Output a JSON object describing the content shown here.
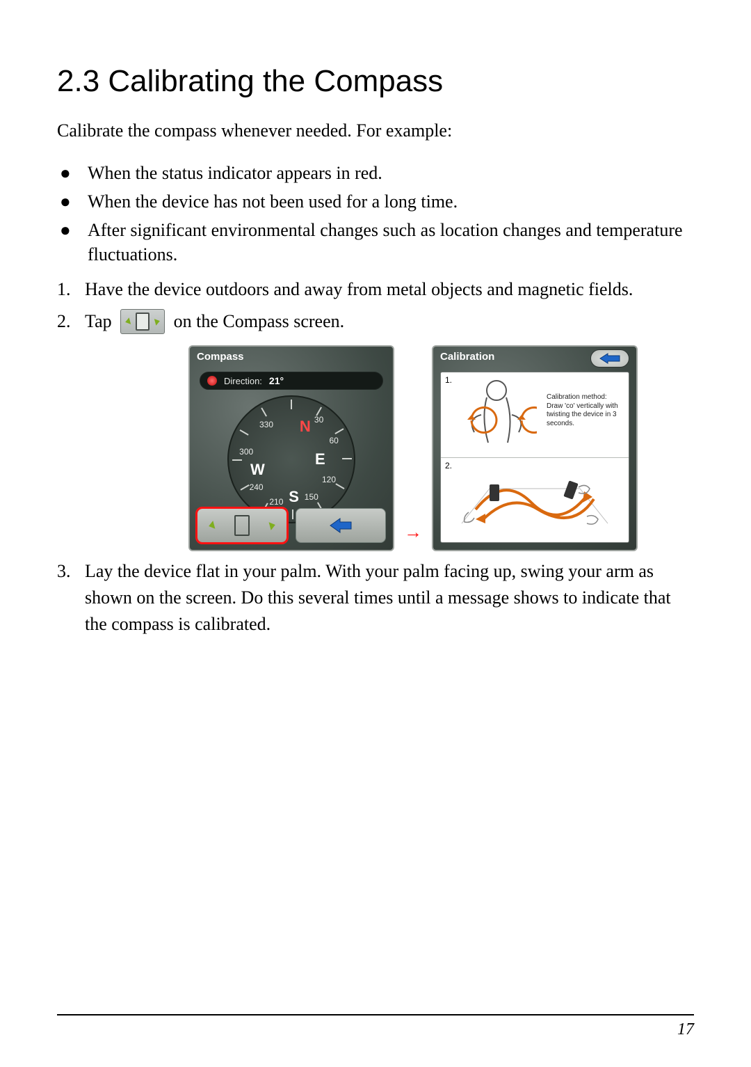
{
  "heading": "2.3   Calibrating the Compass",
  "intro": "Calibrate the compass whenever needed. For example:",
  "bullets": [
    "When the status indicator appears in red.",
    "When the device has not been used for a long time.",
    "After significant environmental changes such as location changes and temperature fluctuations."
  ],
  "steps": {
    "s1": {
      "num": "1.",
      "text": "Have the device outdoors and away from metal objects and magnetic fields."
    },
    "s2": {
      "num": "2.",
      "pre": "Tap",
      "post": "on the Compass screen."
    },
    "s3": {
      "num": "3.",
      "text": "Lay the device flat in your palm. With your palm facing up, swing your arm as shown on the screen. Do this several times until a message shows to indicate that the compass is calibrated."
    }
  },
  "compass_screen": {
    "title": "Compass",
    "direction_label": "Direction:",
    "direction_value": "21°",
    "dial_numbers": [
      "30",
      "60",
      "120",
      "150",
      "210",
      "240",
      "300",
      "330"
    ],
    "cardinals": {
      "N": "N",
      "E": "E",
      "S": "S",
      "W": "W"
    }
  },
  "calibration_screen": {
    "title": "Calibration",
    "row1_num": "1.",
    "row2_num": "2.",
    "method_text": "Calibration method: Draw 'co' vertically with twisting the device in 3 seconds."
  },
  "link_arrow": "→",
  "page_number": "17"
}
